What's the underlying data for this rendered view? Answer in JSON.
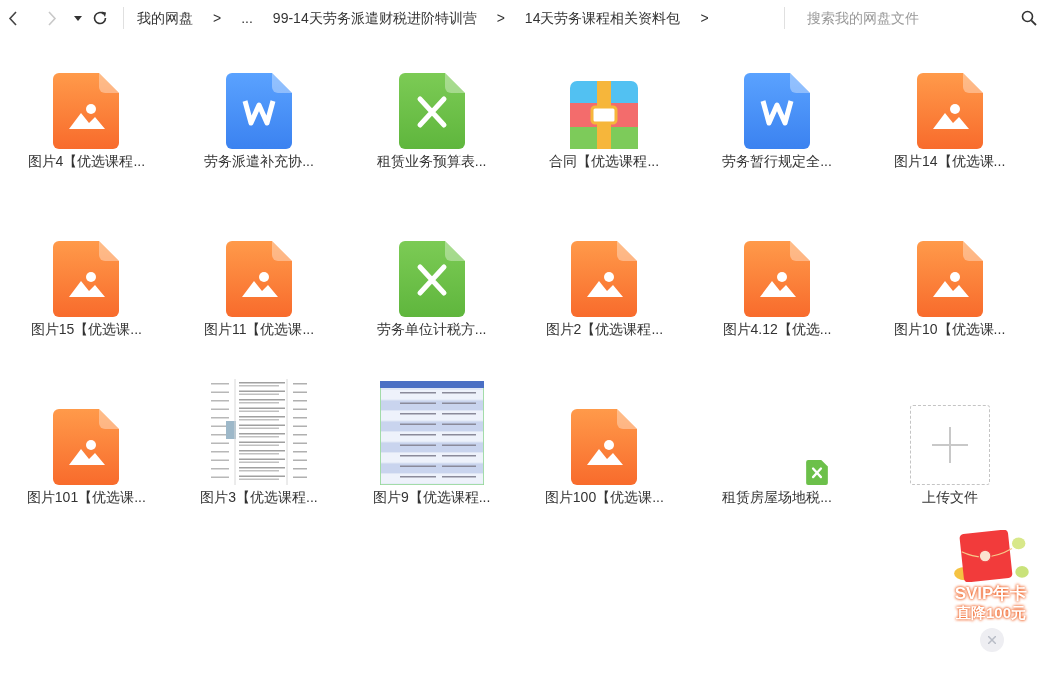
{
  "toolbar": {
    "back": {
      "disabled": false
    },
    "forward": {
      "disabled": true
    },
    "breadcrumbs": [
      {
        "kind": "crumb",
        "text": "我的网盘"
      },
      {
        "kind": "separator",
        "text": ">"
      },
      {
        "kind": "crumb",
        "text": "..."
      },
      {
        "kind": "crumb",
        "text": "99-14天劳务派遣财税进阶特训营"
      },
      {
        "kind": "separator",
        "text": ">"
      },
      {
        "kind": "crumb",
        "text": "14天劳务课程相关资料包"
      },
      {
        "kind": "separator",
        "text": ">"
      }
    ],
    "search": {
      "placeholder": "搜索我的网盘文件"
    }
  },
  "files": [
    {
      "kind": "image",
      "name": "图片4【优选课程..."
    },
    {
      "kind": "word",
      "name": "劳务派遣补充协..."
    },
    {
      "kind": "excel",
      "name": "租赁业务预算表..."
    },
    {
      "kind": "zip",
      "name": "合同【优选课程..."
    },
    {
      "kind": "word",
      "name": "劳务暂行规定全..."
    },
    {
      "kind": "image",
      "name": "图片14【优选课..."
    },
    {
      "kind": "image",
      "name": "图片15【优选课..."
    },
    {
      "kind": "image",
      "name": "图片11【优选课..."
    },
    {
      "kind": "excel",
      "name": "劳务单位计税方..."
    },
    {
      "kind": "image",
      "name": "图片2【优选课程..."
    },
    {
      "kind": "image",
      "name": "图片4.12【优选..."
    },
    {
      "kind": "image",
      "name": "图片10【优选课..."
    },
    {
      "kind": "image",
      "name": "图片101【优选课..."
    },
    {
      "kind": "doc-preview",
      "name": "图片3【优选课程..."
    },
    {
      "kind": "table-preview",
      "name": "图片9【优选课程..."
    },
    {
      "kind": "image",
      "name": "图片100【优选课..."
    },
    {
      "kind": "excel-small",
      "name": "租赁房屋场地税..."
    },
    {
      "kind": "upload",
      "name": "上传文件"
    }
  ],
  "promo": {
    "title": "SVIP年卡",
    "subtitle": "直降100元"
  }
}
